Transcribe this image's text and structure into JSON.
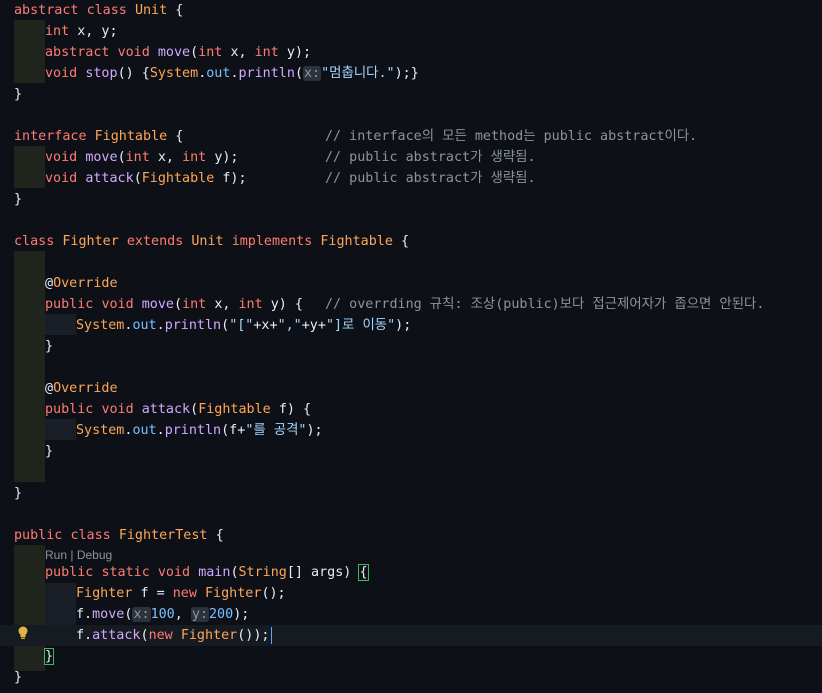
{
  "editor": {
    "codelens": {
      "run": "Run",
      "separator": "|",
      "debug": "Debug"
    },
    "lines": {
      "l1": [
        "abstract",
        "class",
        "Unit",
        "{"
      ],
      "l2": [
        "int",
        "x, y;"
      ],
      "l3": [
        "abstract",
        "void",
        "move",
        "(",
        "int",
        "x,",
        "int",
        "y);"
      ],
      "l4": [
        "void",
        "stop",
        "() {",
        "System",
        ".",
        "out",
        ".",
        "println",
        "(",
        "x:",
        "\"멈춥니다.\"",
        ");}"
      ],
      "l5": [
        "}"
      ],
      "l7": [
        "interface",
        "Fightable",
        "{",
        "// interface의 모든 method는 public abstract이다."
      ],
      "l8": [
        "void",
        "move",
        "(",
        "int",
        "x,",
        "int",
        "y);",
        "// public abstract가 생략됨."
      ],
      "l9": [
        "void",
        "attack",
        "(",
        "Fightable",
        "f);",
        "// public abstract가 생략됨."
      ],
      "l10": [
        "}"
      ],
      "l12": [
        "class",
        "Fighter",
        "extends",
        "Unit",
        "implements",
        "Fightable",
        "{"
      ],
      "l14": [
        "@",
        "Override"
      ],
      "l15": [
        "public",
        "void",
        "move",
        "(",
        "int",
        "x,",
        "int",
        "y) {",
        "// overrding 규칙: 조상(public)보다 접근제어자가 좁으면 안된다."
      ],
      "l16": [
        "System",
        ".",
        "out",
        ".",
        "println",
        "(",
        "\"[\"",
        "+x+",
        "\",\"",
        "+y+",
        "\"]로 이동\"",
        ");"
      ],
      "l17": [
        "}"
      ],
      "l19": [
        "@",
        "Override"
      ],
      "l20": [
        "public",
        "void",
        "attack",
        "(",
        "Fightable",
        "f) {"
      ],
      "l21": [
        "System",
        ".",
        "out",
        ".",
        "println",
        "(f+",
        "\"를 공격\"",
        ");"
      ],
      "l22": [
        "}"
      ],
      "l24": [
        "}"
      ],
      "l26": [
        "public",
        "class",
        "FighterTest",
        "{"
      ],
      "l27": [
        "public",
        "static",
        "void",
        "main",
        "(",
        "String",
        "[] args) ",
        "{"
      ],
      "l28": [
        "Fighter",
        "f = ",
        "new",
        "Fighter",
        "();"
      ],
      "l29": [
        "f.",
        "move",
        "(",
        "x:",
        "100",
        ", ",
        "y:",
        "200",
        ");"
      ],
      "l30": [
        "f.",
        "attack",
        "(",
        "new",
        "Fighter",
        "());"
      ],
      "l31": [
        "}"
      ],
      "l32": [
        "}"
      ]
    }
  },
  "colors": {
    "background": "#0d1117",
    "keyword": "#ff7b72",
    "class": "#ffa657",
    "function": "#d2a8ff",
    "string": "#a5d6ff",
    "comment": "#8b949e",
    "number": "#79c0ff"
  },
  "icons": {
    "lightbulb": "lightbulb-icon"
  }
}
